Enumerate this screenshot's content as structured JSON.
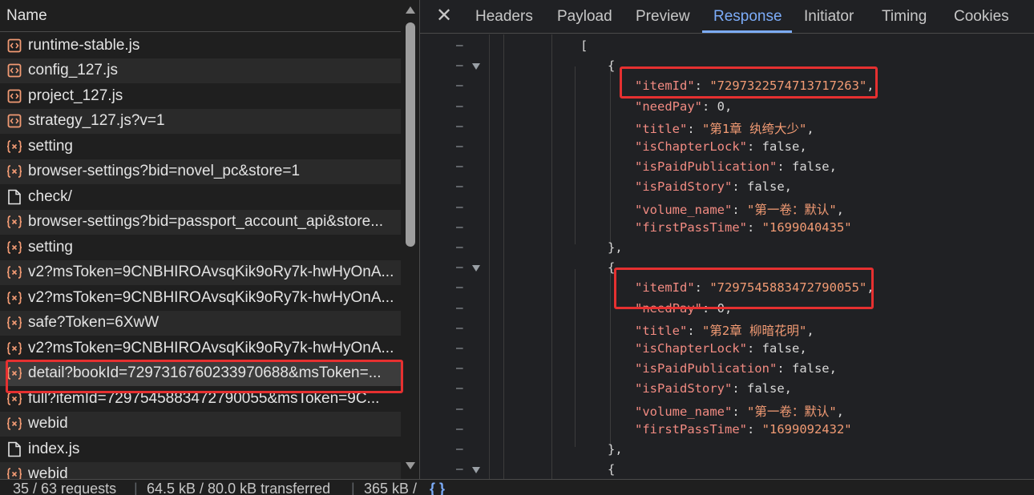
{
  "left": {
    "header": "Name",
    "requests": [
      {
        "name": "runtime-stable.js",
        "icon": "script-icon"
      },
      {
        "name": "config_127.js",
        "icon": "script-icon"
      },
      {
        "name": "project_127.js",
        "icon": "script-icon"
      },
      {
        "name": "strategy_127.js?v=1",
        "icon": "script-icon"
      },
      {
        "name": "setting",
        "icon": "fetch-icon"
      },
      {
        "name": "browser-settings?bid=novel_pc&store=1",
        "icon": "fetch-icon"
      },
      {
        "name": "check/",
        "icon": "document-icon"
      },
      {
        "name": "browser-settings?bid=passport_account_api&store...",
        "icon": "fetch-icon"
      },
      {
        "name": "setting",
        "icon": "fetch-icon"
      },
      {
        "name": "v2?msToken=9CNBHIROAvsqKik9oRy7k-hwHyOnA...",
        "icon": "fetch-icon"
      },
      {
        "name": "v2?msToken=9CNBHIROAvsqKik9oRy7k-hwHyOnA...",
        "icon": "fetch-icon"
      },
      {
        "name": "safe?Token=6XwW",
        "icon": "fetch-icon"
      },
      {
        "name": "v2?msToken=9CNBHIROAvsqKik9oRy7k-hwHyOnA...",
        "icon": "fetch-icon"
      },
      {
        "name": "detail?bookId=7297316760233970688&msToken=...",
        "icon": "fetch-icon"
      },
      {
        "name": "full?itemId=7297545883472790055&msToken=9C...",
        "icon": "fetch-icon"
      },
      {
        "name": "webid",
        "icon": "fetch-icon"
      },
      {
        "name": "index.js",
        "icon": "document-icon"
      },
      {
        "name": "webid",
        "icon": "fetch-icon"
      }
    ]
  },
  "tabs": {
    "close": "✕",
    "items": [
      "Headers",
      "Payload",
      "Preview",
      "Response",
      "Initiator",
      "Timing",
      "Cookies"
    ],
    "active": "Response"
  },
  "response_lines": [
    {
      "indent": 0,
      "fold": false,
      "tokens": [
        [
          "p",
          "["
        ]
      ]
    },
    {
      "indent": 1,
      "fold": true,
      "tokens": [
        [
          "p",
          "{"
        ]
      ]
    },
    {
      "indent": 2,
      "fold": false,
      "tokens": [
        [
          "k",
          "\"itemId\""
        ],
        [
          "p",
          ": "
        ],
        [
          "s",
          "\"7297322574713717263\""
        ],
        [
          "p",
          ","
        ]
      ]
    },
    {
      "indent": 2,
      "fold": false,
      "tokens": [
        [
          "k",
          "\"needPay\""
        ],
        [
          "p",
          ": "
        ],
        [
          "n",
          "0"
        ],
        [
          "p",
          ","
        ]
      ]
    },
    {
      "indent": 2,
      "fold": false,
      "tokens": [
        [
          "k",
          "\"title\""
        ],
        [
          "p",
          ": "
        ],
        [
          "s",
          "\"第1章 纨绔大少\""
        ],
        [
          "p",
          ","
        ]
      ]
    },
    {
      "indent": 2,
      "fold": false,
      "tokens": [
        [
          "k",
          "\"isChapterLock\""
        ],
        [
          "p",
          ": "
        ],
        [
          "n",
          "false"
        ],
        [
          "p",
          ","
        ]
      ]
    },
    {
      "indent": 2,
      "fold": false,
      "tokens": [
        [
          "k",
          "\"isPaidPublication\""
        ],
        [
          "p",
          ": "
        ],
        [
          "n",
          "false"
        ],
        [
          "p",
          ","
        ]
      ]
    },
    {
      "indent": 2,
      "fold": false,
      "tokens": [
        [
          "k",
          "\"isPaidStory\""
        ],
        [
          "p",
          ": "
        ],
        [
          "n",
          "false"
        ],
        [
          "p",
          ","
        ]
      ]
    },
    {
      "indent": 2,
      "fold": false,
      "tokens": [
        [
          "k",
          "\"volume_name\""
        ],
        [
          "p",
          ": "
        ],
        [
          "s",
          "\"第一卷：默认\""
        ],
        [
          "p",
          ","
        ]
      ]
    },
    {
      "indent": 2,
      "fold": false,
      "tokens": [
        [
          "k",
          "\"firstPassTime\""
        ],
        [
          "p",
          ": "
        ],
        [
          "s",
          "\"1699040435\""
        ]
      ]
    },
    {
      "indent": 1,
      "fold": false,
      "tokens": [
        [
          "p",
          "},"
        ]
      ]
    },
    {
      "indent": 1,
      "fold": true,
      "tokens": [
        [
          "p",
          "{"
        ]
      ]
    },
    {
      "indent": 2,
      "fold": false,
      "tokens": [
        [
          "k",
          "\"itemId\""
        ],
        [
          "p",
          ": "
        ],
        [
          "s",
          "\"7297545883472790055\""
        ],
        [
          "p",
          ","
        ]
      ]
    },
    {
      "indent": 2,
      "fold": false,
      "tokens": [
        [
          "k",
          "\"needPay\""
        ],
        [
          "p",
          ": "
        ],
        [
          "n",
          "0"
        ],
        [
          "p",
          ","
        ]
      ]
    },
    {
      "indent": 2,
      "fold": false,
      "tokens": [
        [
          "k",
          "\"title\""
        ],
        [
          "p",
          ": "
        ],
        [
          "s",
          "\"第2章 柳暗花明\""
        ],
        [
          "p",
          ","
        ]
      ]
    },
    {
      "indent": 2,
      "fold": false,
      "tokens": [
        [
          "k",
          "\"isChapterLock\""
        ],
        [
          "p",
          ": "
        ],
        [
          "n",
          "false"
        ],
        [
          "p",
          ","
        ]
      ]
    },
    {
      "indent": 2,
      "fold": false,
      "tokens": [
        [
          "k",
          "\"isPaidPublication\""
        ],
        [
          "p",
          ": "
        ],
        [
          "n",
          "false"
        ],
        [
          "p",
          ","
        ]
      ]
    },
    {
      "indent": 2,
      "fold": false,
      "tokens": [
        [
          "k",
          "\"isPaidStory\""
        ],
        [
          "p",
          ": "
        ],
        [
          "n",
          "false"
        ],
        [
          "p",
          ","
        ]
      ]
    },
    {
      "indent": 2,
      "fold": false,
      "tokens": [
        [
          "k",
          "\"volume_name\""
        ],
        [
          "p",
          ": "
        ],
        [
          "s",
          "\"第一卷：默认\""
        ],
        [
          "p",
          ","
        ]
      ]
    },
    {
      "indent": 2,
      "fold": false,
      "tokens": [
        [
          "k",
          "\"firstPassTime\""
        ],
        [
          "p",
          ": "
        ],
        [
          "s",
          "\"1699092432\""
        ]
      ]
    },
    {
      "indent": 1,
      "fold": false,
      "tokens": [
        [
          "p",
          "},"
        ]
      ]
    },
    {
      "indent": 1,
      "fold": true,
      "tokens": [
        [
          "p",
          "{"
        ]
      ]
    }
  ],
  "status": {
    "requests": "35 / 63 requests",
    "transferred": "64.5 kB / 80.0 kB transferred",
    "resources": "365 kB /",
    "pretty_print": "{ }"
  },
  "colors": {
    "accent": "#7cacf8",
    "highlight": "#e63030",
    "json_key": "#f28b82",
    "json_string": "#f29b74"
  }
}
